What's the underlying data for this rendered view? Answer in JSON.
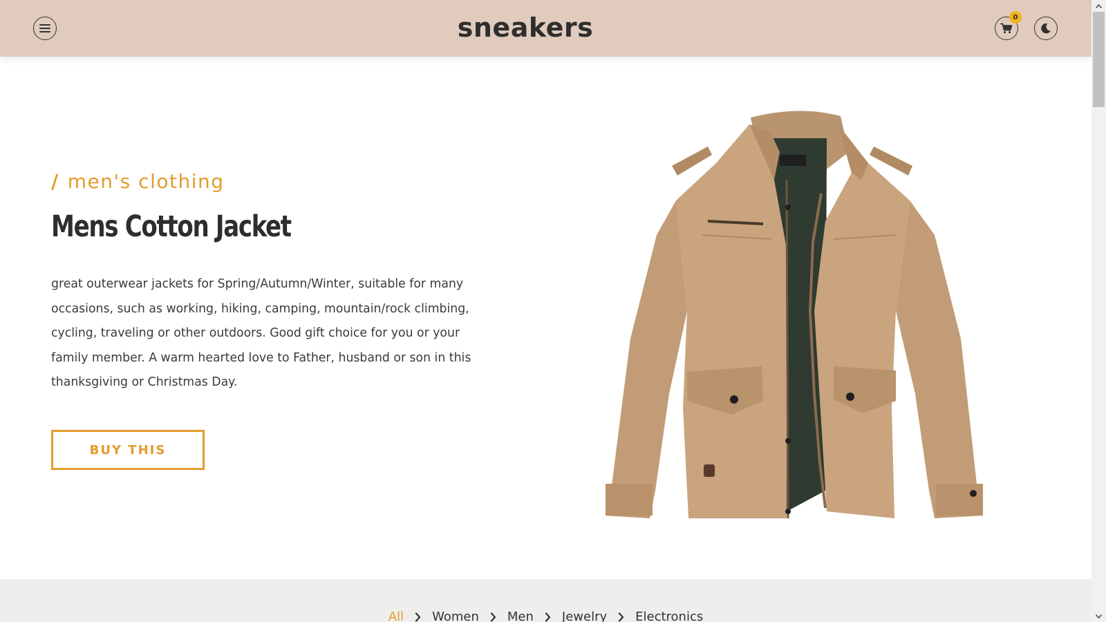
{
  "header": {
    "brand": "sneakers",
    "cart_count": "0"
  },
  "hero": {
    "category_slash": "/",
    "category": "men's clothing",
    "title": "Mens Cotton Jacket",
    "description": "great outerwear jackets for Spring/Autumn/Winter, suitable for many occasions, such as working, hiking, camping, mountain/rock climbing, cycling, traveling or other outdoors. Good gift choice for you or your family member. A warm hearted love to Father, husband or son in this thanksgiving or Christmas Day.",
    "buy_label": "BUY THIS"
  },
  "categories": {
    "items": [
      "All",
      "Women",
      "Men",
      "Jewelry",
      "Electronics"
    ],
    "active": "All"
  },
  "icons": {
    "menu": "hamburger-menu-icon",
    "cart": "shopping-cart-icon",
    "theme": "moon-icon",
    "separator": "chevron-right-icon"
  },
  "colors": {
    "header_bg": "#e1cbbd",
    "accent": "#e39c2b",
    "badge": "#f0b41e",
    "category_bar_bg": "#efeeed"
  }
}
